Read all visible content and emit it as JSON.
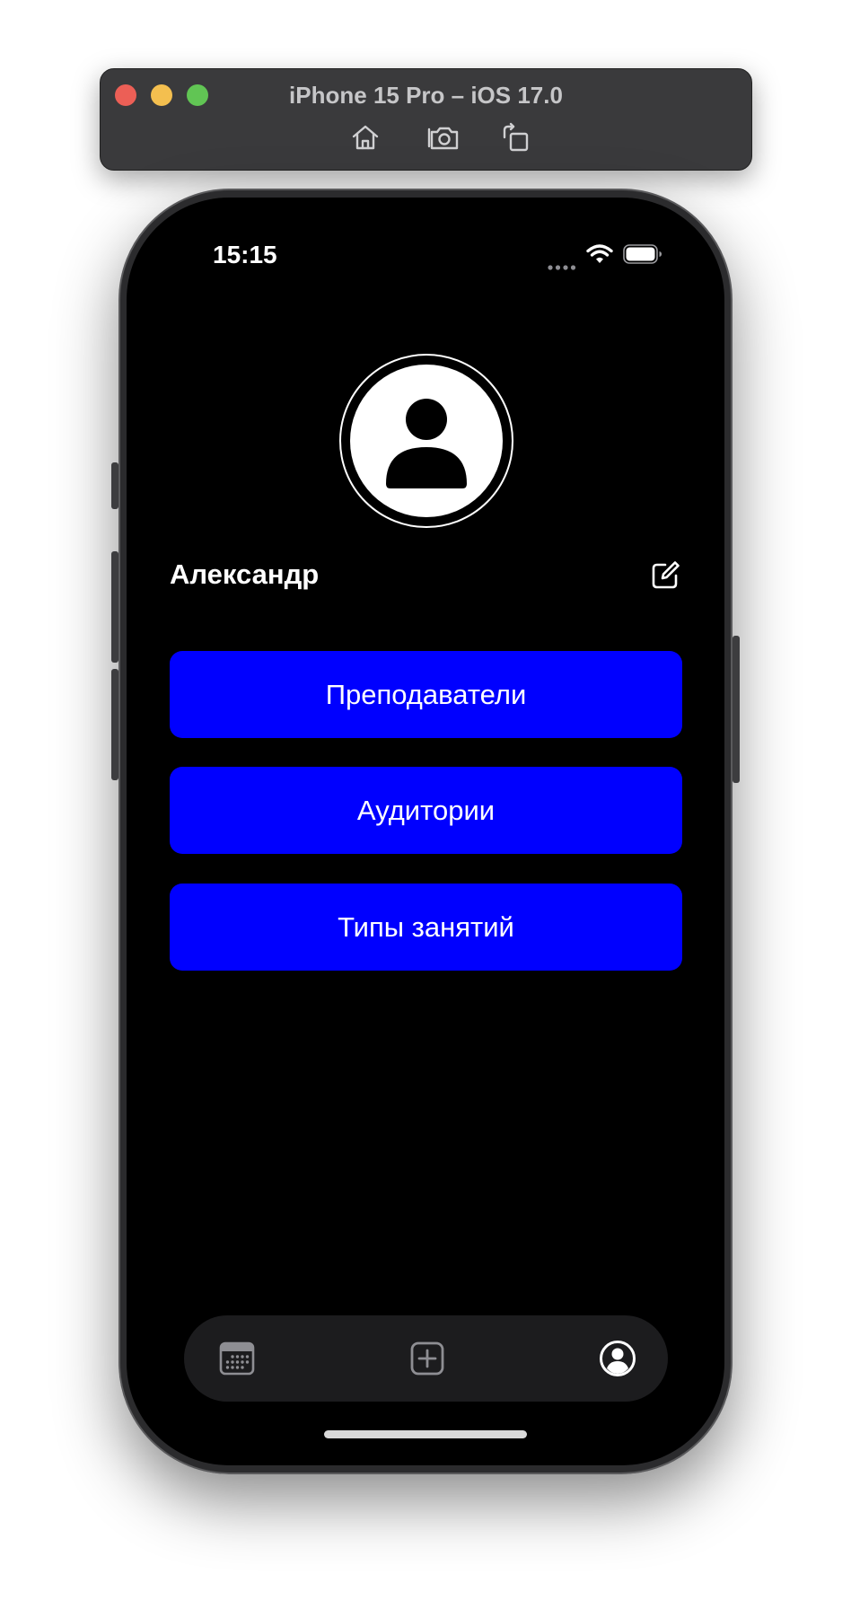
{
  "simulator": {
    "title": "iPhone 15 Pro – iOS 17.0",
    "tools": [
      "home-icon",
      "screenshot-icon",
      "rotate-icon"
    ]
  },
  "status_bar": {
    "time": "15:15",
    "icons": [
      "cellular-dots-icon",
      "wifi-icon",
      "battery-icon"
    ]
  },
  "profile": {
    "avatar_icon": "person-circle-icon",
    "name": "Александр",
    "edit_icon": "edit-icon"
  },
  "menu": {
    "items": [
      {
        "label": "Преподаватели"
      },
      {
        "label": "Аудитории"
      },
      {
        "label": "Типы занятий"
      }
    ]
  },
  "tabbar": {
    "tabs": [
      {
        "icon": "calendar-icon",
        "selected": false
      },
      {
        "icon": "plus-square-icon",
        "selected": false
      },
      {
        "icon": "profile-icon",
        "selected": true
      }
    ]
  },
  "colors": {
    "accent": "#0000ff",
    "background": "#000000",
    "tabbar_bg": "#1c1c1e",
    "inactive_icon": "#8e8e93",
    "active_icon": "#ffffff"
  }
}
